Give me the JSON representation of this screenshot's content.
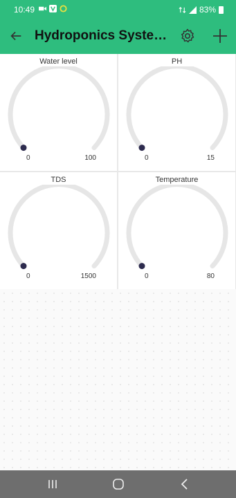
{
  "status_bar": {
    "time": "10:49",
    "battery": "83%"
  },
  "app_bar": {
    "title": "Hydroponics System..."
  },
  "widgets": [
    {
      "label": "Water level",
      "min": "0",
      "max": "100",
      "value": 0
    },
    {
      "label": "PH",
      "min": "0",
      "max": "15",
      "value": 0
    },
    {
      "label": "TDS",
      "min": "0",
      "max": "1500",
      "value": 0
    },
    {
      "label": "Temperature",
      "min": "0",
      "max": "80",
      "value": 0
    }
  ],
  "colors": {
    "accent": "#2ebd7e",
    "gauge_track": "#e6e6e6",
    "gauge_knob": "#2d2b4e",
    "nav_bar": "#6e6e6e"
  },
  "icons": [
    "back-arrow-icon",
    "settings-gear-icon",
    "add-plus-icon",
    "recents-icon",
    "home-icon",
    "nav-back-icon"
  ]
}
